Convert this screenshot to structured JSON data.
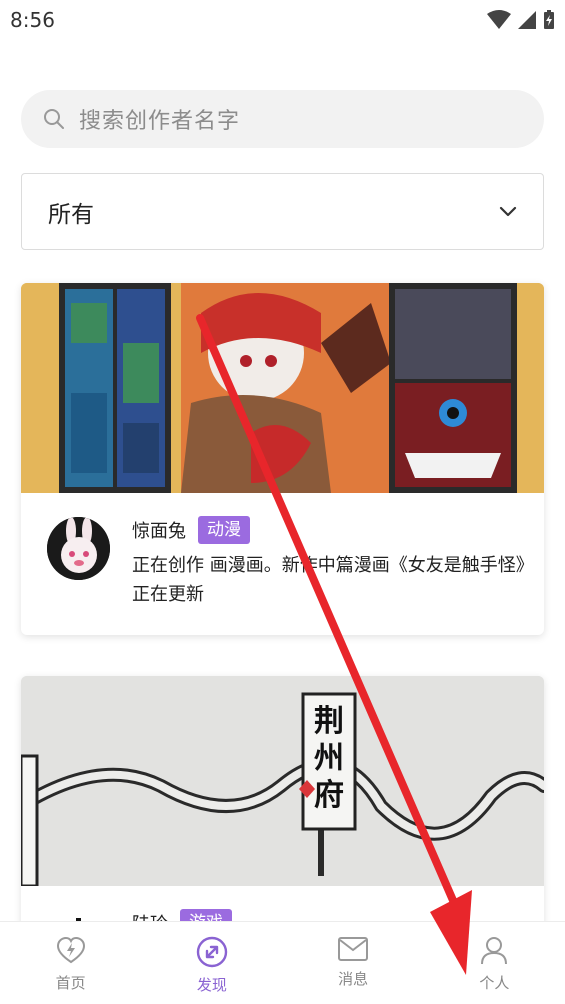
{
  "status_bar": {
    "time": "8:56"
  },
  "search": {
    "placeholder": "搜索创作者名字"
  },
  "filter": {
    "selected": "所有"
  },
  "cards": [
    {
      "author": "惊面兔",
      "tag": "动漫",
      "description": "正在创作 画漫画。新作中篇漫画《女友是触手怪》正在更新"
    },
    {
      "author": "陆玲",
      "tag": "游戏",
      "banner_text": "荆州府"
    }
  ],
  "bottom_nav": {
    "items": [
      {
        "label": "首页",
        "icon": "home-heart-icon"
      },
      {
        "label": "发现",
        "icon": "discover-icon"
      },
      {
        "label": "消息",
        "icon": "message-icon"
      },
      {
        "label": "个人",
        "icon": "person-icon"
      }
    ],
    "active_index": 1
  },
  "colors": {
    "accent": "#8a63d2",
    "tag": "#9b6be0",
    "annotation_arrow": "#e8262b"
  }
}
